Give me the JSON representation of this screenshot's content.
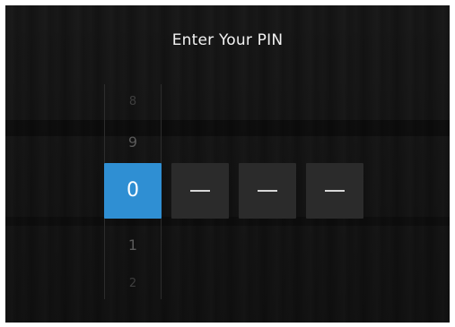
{
  "title": "Enter Your PIN",
  "picker": {
    "above": [
      "8",
      "9"
    ],
    "selected": "0",
    "below": [
      "1",
      "2"
    ]
  },
  "pin_slots": [
    {
      "value": "0",
      "state": "active"
    },
    {
      "value": "",
      "state": "empty"
    },
    {
      "value": "",
      "state": "empty"
    },
    {
      "value": "",
      "state": "empty"
    }
  ],
  "colors": {
    "accent": "#2f8fd3",
    "background": "#141414",
    "slot_empty": "#2b2b2b"
  }
}
